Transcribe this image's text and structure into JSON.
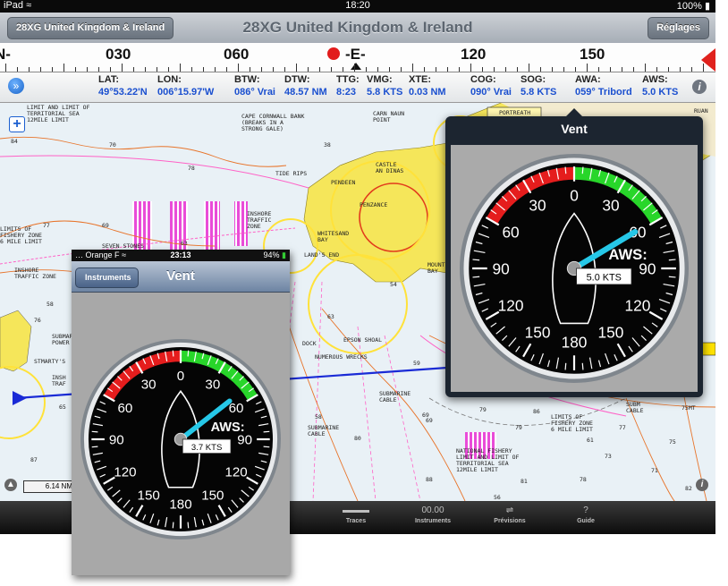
{
  "status_bar": {
    "device": "iPad",
    "wifi_icon": "wifi-icon",
    "time": "18:20",
    "battery": "100%",
    "battery_icon": "battery-icon"
  },
  "nav": {
    "back_label": "28XG United Kingdom & Ireland",
    "title": "28XG United Kingdom & Ireland",
    "right_label": "Réglages"
  },
  "compass": {
    "labels": [
      "N-",
      "030",
      "060",
      "-E-",
      "120",
      "150"
    ],
    "accent": "#e21c1c"
  },
  "data_bar": {
    "fields": [
      {
        "key": "LAT:",
        "value": "49°53.22'N"
      },
      {
        "key": "LON:",
        "value": "006°15.97'W"
      },
      {
        "key": "BTW:",
        "value": "086° Vrai"
      },
      {
        "key": "DTW:",
        "value": "48.57 NM"
      },
      {
        "key": "TTG:",
        "value": "8:23"
      },
      {
        "key": "VMG:",
        "value": "5.8 KTS"
      },
      {
        "key": "XTE:",
        "value": "0.03 NM"
      },
      {
        "key": "COG:",
        "value": "090° Vrai"
      },
      {
        "key": "SOG:",
        "value": "5.8 KTS"
      },
      {
        "key": "AWA:",
        "value": "059° Tribord"
      },
      {
        "key": "AWS:",
        "value": "5.0 KTS"
      }
    ],
    "value_color": "#1a4fcf"
  },
  "map": {
    "labels": [
      "LIMIT AND LIMIT OF\nTERRITORIAL SEA\n12MILE LIMIT",
      "CAPE CORNWALL BANK\n(BREAKS IN A\nSTRONG GALE)",
      "CARN NAUN\nPOINT",
      "PORTREATH",
      "RUAN",
      "TIDE RIPS",
      "PENDEEN",
      "CASTLE\nAN DINAS",
      "PENZANCE",
      "INSHORE\nTRAFFIC\nZONE",
      "WHITESAND\nBAY",
      "LAND'S END",
      "SEVEN STONES",
      "LIMITS OF\nFISHERY ZONE\n6 MILE LIMIT",
      "INSHORE\nTRAFFIC ZONE",
      "MOUNTS\nBAY",
      "EPSON SHOAL",
      "NUMEROUS WRECKS",
      "SUBMARINE\nCABLE",
      "SUBMARINE\nCABLE",
      "NATIONAL FISHERY\nLIMIT AND LIMIT OF\nTERRITORIAL SEA\n12MILE LIMIT",
      "LIMITS OF\nFISHERY ZONE\n6 MILE LIMIT",
      "SUBM\nCABLE",
      "SUBMARINE\nPOWER",
      "STMARTY'S",
      "INSH\nTRAF",
      "DOCK",
      "75MT"
    ],
    "depths": [
      "84",
      "70",
      "78",
      "38",
      "69",
      "77",
      "63",
      "58",
      "59",
      "76",
      "65",
      "87",
      "54",
      "84",
      "79",
      "63",
      "80",
      "69",
      "69",
      "88",
      "86",
      "79",
      "77",
      "75",
      "61",
      "71",
      "78",
      "81",
      "58",
      "82",
      "73",
      "56"
    ],
    "scale": "6.14 NM",
    "zoom_icon": "plus-icon"
  },
  "tab_bar": [
    {
      "label": "Traces",
      "icon": "traces-icon"
    },
    {
      "label": "Instruments",
      "value": "00.00"
    },
    {
      "label": "Prévisions",
      "icon": "forecast-icon"
    },
    {
      "label": "Guide",
      "value": "?"
    }
  ],
  "popover": {
    "title": "Vent",
    "gauge": {
      "angles": [
        "0",
        "30",
        "60",
        "90",
        "120",
        "150",
        "180",
        "150",
        "120",
        "90",
        "60",
        "30"
      ],
      "aws_label": "AWS:",
      "aws_value": "5.0 KTS",
      "awa_deg": 59
    }
  },
  "iphone": {
    "carrier": "Orange F",
    "time": "23:13",
    "battery": "94%",
    "back_label": "Instruments",
    "title": "Vent",
    "gauge": {
      "angles": [
        "0",
        "30",
        "60",
        "90",
        "120",
        "150",
        "180",
        "150",
        "120",
        "90",
        "60",
        "30"
      ],
      "aws_label": "AWS:",
      "aws_value": "3.7 KTS",
      "awa_deg": 52
    }
  },
  "colors": {
    "red_sector": "#e51d1d",
    "green_sector": "#28d62a",
    "needle": "#26c8e8",
    "chart_land": "#f5e65a",
    "chart_magenta": "#e000c8",
    "track": "#1a2bd6"
  }
}
